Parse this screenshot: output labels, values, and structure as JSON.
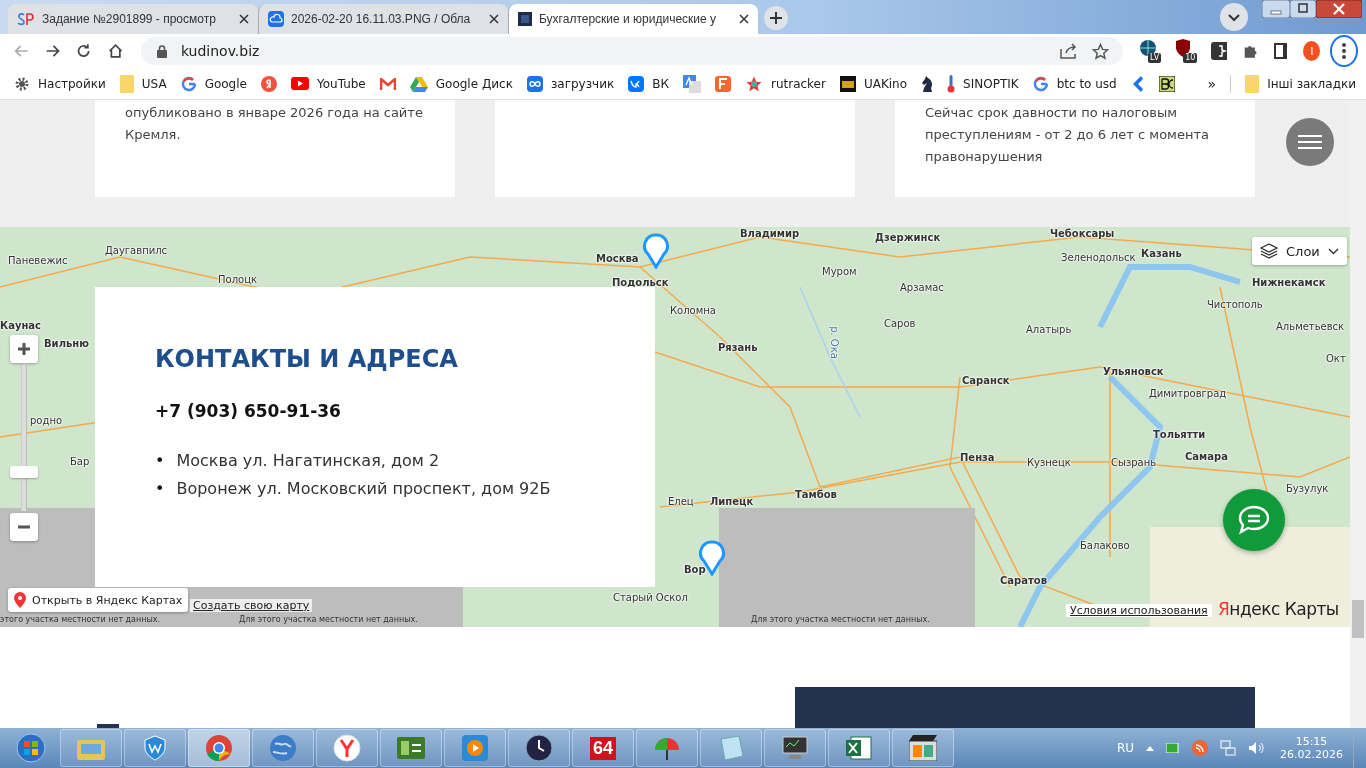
{
  "browser": {
    "tabs": [
      {
        "title": "Задание №2901899 - просмотр",
        "selected": false
      },
      {
        "title": "2026-02-20 16.11.03.PNG / Обла",
        "selected": false
      },
      {
        "title": "Бухгалтерские и юридические у",
        "selected": true
      }
    ],
    "address": "kudinov.biz",
    "extension_badges": [
      "LV",
      "10"
    ],
    "profile_initial": "I",
    "bookmarks": [
      {
        "kind": "link",
        "label": "Настройки"
      },
      {
        "kind": "link",
        "label": "USA"
      },
      {
        "kind": "link",
        "label": "Google"
      },
      {
        "kind": "icon"
      },
      {
        "kind": "link",
        "label": "YouTube"
      },
      {
        "kind": "icon"
      },
      {
        "kind": "link",
        "label": "Google Диск"
      },
      {
        "kind": "link",
        "label": "загрузчик"
      },
      {
        "kind": "link",
        "label": "ВК"
      },
      {
        "kind": "icon"
      },
      {
        "kind": "icon"
      },
      {
        "kind": "link",
        "label": "rutracker"
      },
      {
        "kind": "link",
        "label": "UAKino"
      },
      {
        "kind": "icon"
      },
      {
        "kind": "link",
        "label": "SINOPTIK"
      },
      {
        "kind": "link",
        "label": "btc to usd"
      },
      {
        "kind": "icon"
      },
      {
        "kind": "icon"
      }
    ],
    "more_bookmarks": "»",
    "other_bookmarks": "Інші закладки"
  },
  "cards": [
    {
      "kind": "text",
      "lines": [
        "опубликовано в январе 2026 года на сайте",
        "Кремля."
      ]
    },
    {
      "kind": "blank"
    },
    {
      "kind": "text",
      "lines": [
        "Сейчас срок давности по налоговым преступлениям - от 2 до 6 лет с момента правонарушения"
      ]
    }
  ],
  "map": {
    "zoom": {
      "level": 0.25
    },
    "layers_button": "Слои",
    "open_button": "Открыть в Яндекс Картах",
    "create_link": "Создать свою карту",
    "terms_link": "Условия использования",
    "logo": "Яндекс Карты",
    "no_data": [
      "этого участка местности нет данных.",
      "Для этого участка местности нет данных.",
      "Для этого участка местности нет данных."
    ],
    "labels": [
      {
        "name": "Даугавпилс",
        "kind": "minor"
      },
      {
        "name": "Паневежис",
        "kind": "minor"
      },
      {
        "name": "Полоцк",
        "kind": "minor"
      },
      {
        "name": "Каунас",
        "kind": "major"
      },
      {
        "name": "Вильню",
        "kind": "major"
      },
      {
        "name": "родно",
        "kind": "minor"
      },
      {
        "name": "Бар",
        "kind": "minor"
      },
      {
        "name": "Москва",
        "kind": "major"
      },
      {
        "name": "Подольск",
        "kind": "major"
      },
      {
        "name": "Коломна",
        "kind": "minor"
      },
      {
        "name": "Рязань",
        "kind": "major"
      },
      {
        "name": "Владимир",
        "kind": "major"
      },
      {
        "name": "Дзержинск",
        "kind": "major"
      },
      {
        "name": "Чебоксары",
        "kind": "major"
      },
      {
        "name": "Муром",
        "kind": "minor"
      },
      {
        "name": "Арзамас",
        "kind": "minor"
      },
      {
        "name": "Зеленодольск",
        "kind": "minor"
      },
      {
        "name": "Казань",
        "kind": "major"
      },
      {
        "name": "Нижнекамск",
        "kind": "major"
      },
      {
        "name": "Чистополь",
        "kind": "minor"
      },
      {
        "name": "Саров",
        "kind": "minor"
      },
      {
        "name": "р. Ока",
        "kind": "river"
      },
      {
        "name": "Алатырь",
        "kind": "minor"
      },
      {
        "name": "Альметьевск",
        "kind": "minor"
      },
      {
        "name": "Окт",
        "kind": "minor"
      },
      {
        "name": "Саранск",
        "kind": "major"
      },
      {
        "name": "Ульяновск",
        "kind": "major"
      },
      {
        "name": "Димитровград",
        "kind": "minor"
      },
      {
        "name": "Тольятти",
        "kind": "major"
      },
      {
        "name": "Самара",
        "kind": "major"
      },
      {
        "name": "Пенза",
        "kind": "major"
      },
      {
        "name": "Кузнецк",
        "kind": "minor"
      },
      {
        "name": "Сызрань",
        "kind": "minor"
      },
      {
        "name": "Бузулук",
        "kind": "minor"
      },
      {
        "name": "Елец",
        "kind": "minor"
      },
      {
        "name": "Липецк",
        "kind": "major"
      },
      {
        "name": "Тамбов",
        "kind": "major"
      },
      {
        "name": "Балаково",
        "kind": "minor"
      },
      {
        "name": "Вор",
        "kind": "major"
      },
      {
        "name": "Старый Оскол",
        "kind": "minor"
      },
      {
        "name": "Саратов",
        "kind": "major"
      }
    ]
  },
  "contacts": {
    "title": "КОНТАКТЫ И АДРЕСА",
    "phone": "+7 (903) 650-91-36",
    "bullet": "•",
    "addresses": [
      "Москва ул. Нагатинская, дом 2",
      "Воронеж ул. Московский проспект, дом 92Б"
    ]
  },
  "taskbar": {
    "badge_app": "64",
    "language": "RU",
    "time": "15:15",
    "date": "26.02.2026"
  }
}
